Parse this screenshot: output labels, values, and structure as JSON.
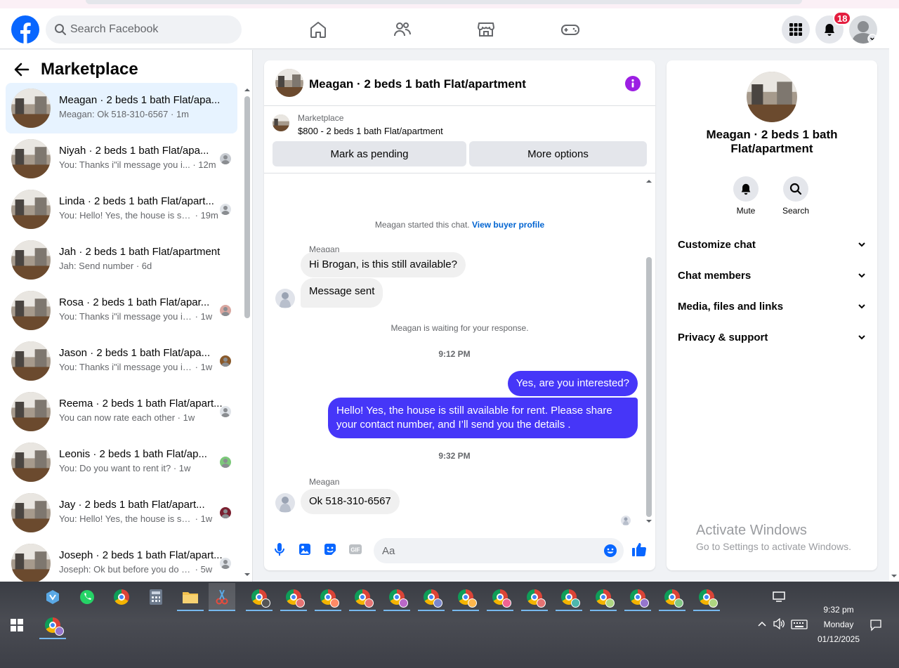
{
  "navbar": {
    "search_placeholder": "Search Facebook",
    "notification_count": "18",
    "brand_color": "#0866ff"
  },
  "marketplace": {
    "title": "Marketplace",
    "chats": [
      {
        "name": "Meagan · 2 beds 1 bath Flat/apa...",
        "preview": "Meagan: Ok 518-310-6567",
        "time": "1m",
        "active": true
      },
      {
        "name": "Niyah · 2 beds 1 bath Flat/apa...",
        "preview": "You: Thanks i\"il message you i...",
        "time": "12m"
      },
      {
        "name": "Linda · 2 beds 1 bath Flat/apart...",
        "preview": "You: Hello! Yes, the house is still a...",
        "time": "19m"
      },
      {
        "name": "Jah · 2 beds 1 bath Flat/apartment",
        "preview": "Jah: Send number",
        "time": "6d"
      },
      {
        "name": "Rosa · 2 beds 1 bath Flat/apar...",
        "preview": "You: Thanks i\"il message you in ...",
        "time": "1w"
      },
      {
        "name": "Jason · 2 beds 1 bath Flat/apa...",
        "preview": "You: Thanks i\"il message you in ...",
        "time": "1w"
      },
      {
        "name": "Reema · 2 beds 1 bath Flat/apart...",
        "preview": "You can now rate each other",
        "time": "1w"
      },
      {
        "name": "Leonis · 2 beds 1 bath Flat/ap...",
        "preview": "You: Do you want to rent it?",
        "time": "1w"
      },
      {
        "name": "Jay · 2 beds 1 bath Flat/apart...",
        "preview": "You: Hello! Yes, the house is still ...",
        "time": "1w"
      },
      {
        "name": "Joseph · 2 beds 1 bath Flat/apart...",
        "preview": "Joseph: Ok but before you do is th...",
        "time": "5w"
      }
    ]
  },
  "conversation": {
    "title": "Meagan · 2 beds 1 bath Flat/apartment",
    "listing_source": "Marketplace",
    "listing_price": "$800 - 2 beds 1 bath Flat/apartment",
    "mark_pending": "Mark as pending",
    "more_options": "More options",
    "started_text": "Meagan started this chat.",
    "view_profile": "View buyer profile",
    "sender_name": "Meagan",
    "msg1": "Hi Brogan, is this still available?",
    "msg2": "Message sent",
    "waiting": "Meagan is waiting for your response.",
    "time1": "9:12 PM",
    "out1": "Yes, are you interested?",
    "out2": "Hello! Yes, the house is still available for rent. Please share your contact number, and I’ll send you the details .",
    "time2": "9:32 PM",
    "sender_name2": "Meagan",
    "msg3": "Ok 518-310-6567",
    "composer_placeholder": "Aa",
    "outgoing_color": "#4636f8"
  },
  "details": {
    "name": "Meagan · 2 beds 1 bath Flat/apartment",
    "mute": "Mute",
    "search": "Search",
    "sections": [
      "Customize chat",
      "Chat members",
      "Media, files and links",
      "Privacy & support"
    ]
  },
  "watermark": {
    "line1": "Activate Windows",
    "line2": "Go to Settings to activate Windows."
  },
  "taskbar": {
    "time": "9:32 pm",
    "day": "Monday",
    "date": "01/12/2025"
  }
}
